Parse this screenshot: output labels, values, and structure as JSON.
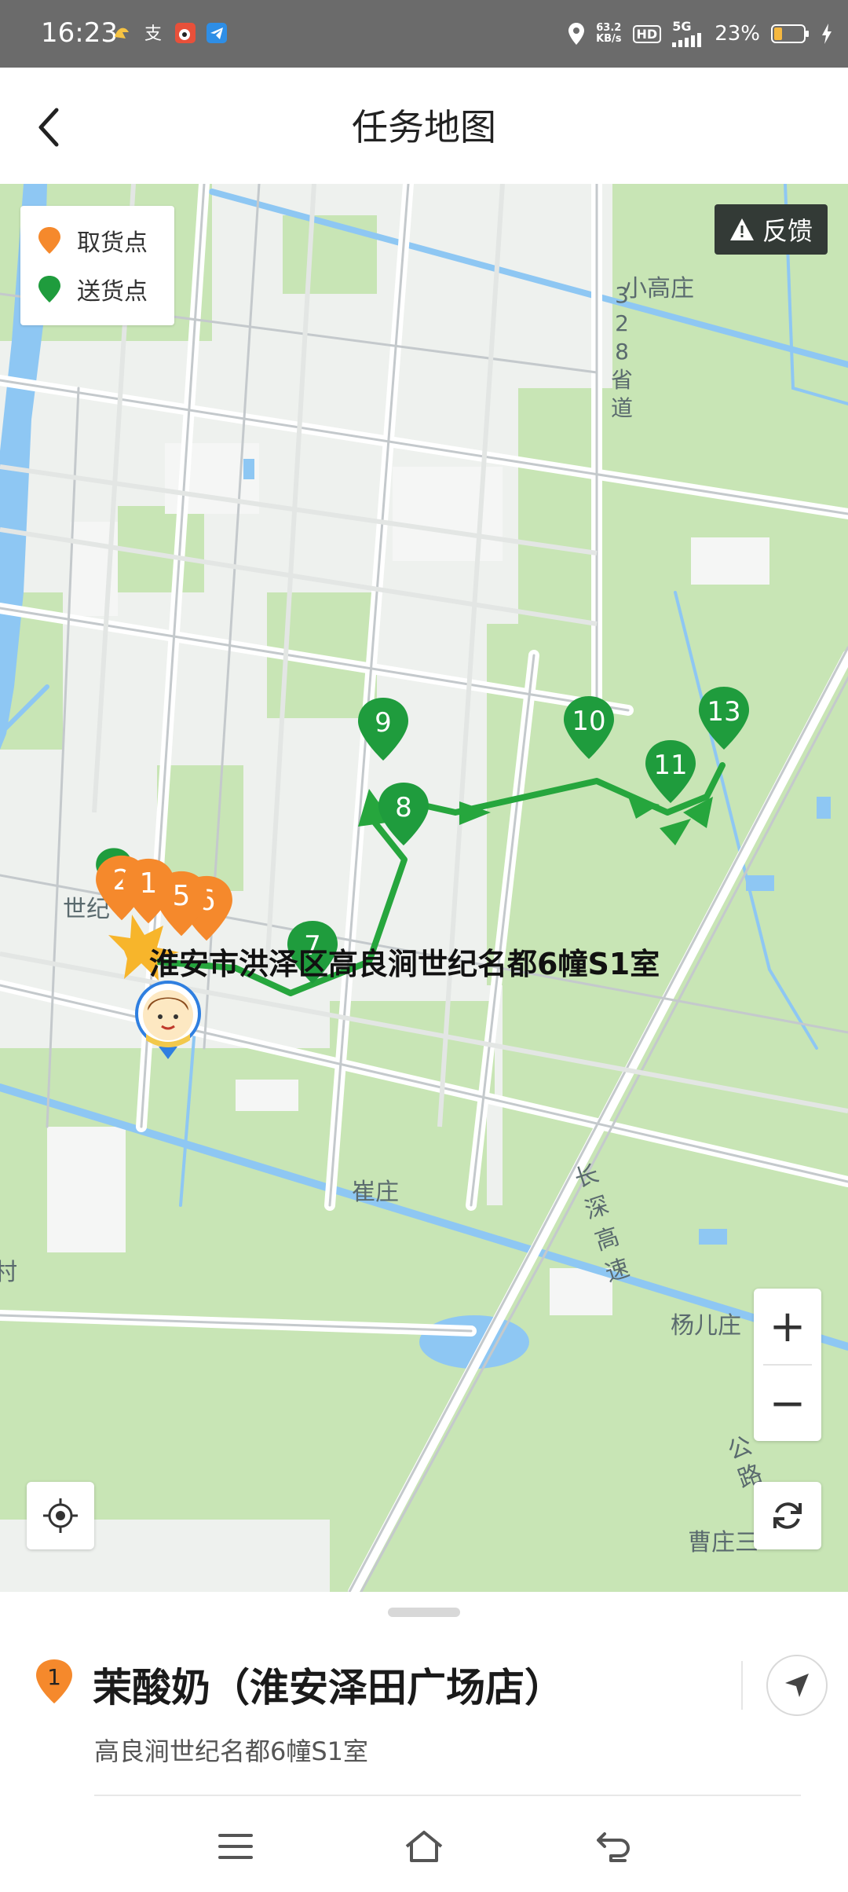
{
  "status_bar": {
    "time": "16:23",
    "net_speed_value": "63.2",
    "net_speed_unit": "KB/s",
    "hd": "HD",
    "network": "5G",
    "battery": "23%"
  },
  "header": {
    "title": "任务地图"
  },
  "legend": {
    "pickup_label": "取货点",
    "delivery_label": "送货点"
  },
  "feedback_label": "反馈",
  "map": {
    "labels": {
      "xiaogaozhuang": "小高庄",
      "road_328_1": "3",
      "road_328_2": "2",
      "road_328_3": "8",
      "road_328_4": "省",
      "road_328_5": "道",
      "cuizhuang": "崔庄",
      "changshen_1": "长",
      "changshen_2": "深",
      "changshen_3": "高",
      "changshen_4": "速",
      "yangerzhuang": "杨儿庄",
      "caozhuang": "曹庄三",
      "gonglu_1": "公",
      "gonglu_2": "路",
      "shiji": "世纪",
      "cun": "村"
    },
    "pickup_markers": [
      "2",
      "1",
      "5",
      "6"
    ],
    "delivery_markers": [
      "9",
      "10",
      "13",
      "11",
      "8",
      "7"
    ],
    "address_label": "淮安市洪泽区高良涧世纪名都6幢S1室",
    "colors": {
      "pickup": "#f5892c",
      "delivery": "#1f9c3d",
      "route": "#26a63d"
    }
  },
  "controls": {
    "zoom_in": "+",
    "zoom_out": "−"
  },
  "bottom_sheet": {
    "store_index": "1",
    "store_name": "茉酸奶（淮安泽田广场店）",
    "store_address": "高良涧世纪名都6幢S1室"
  }
}
